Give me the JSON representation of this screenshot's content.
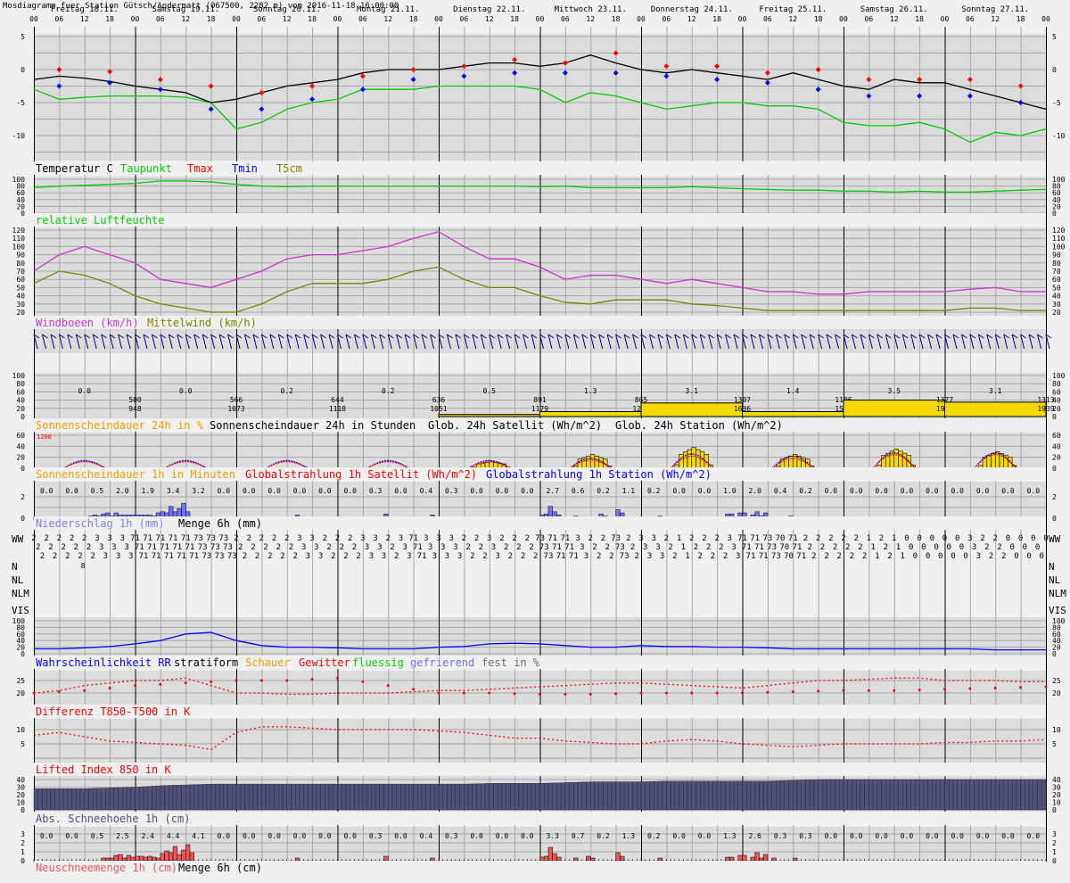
{
  "title": "Mosdiagramm fuer Station Gütsch/Andermatt (067500, 2282 m) vom 2016-11-18 16:00:00",
  "colors": {
    "temp": "#000000",
    "dew": "#00cc00",
    "tmax": "#ff0000",
    "tmin": "#0000ff",
    "gust": "#cc33cc",
    "mean": "#808000",
    "sun": "#f0a000",
    "sunbar": "#f5d800",
    "precip": "#7070ff",
    "snowh": "#50507a",
    "newsnow": "#ee5555",
    "plotbg": "#dcdcdc",
    "grid": "#a8a8a8"
  },
  "chart_data": {
    "type": "meteogram",
    "days": [
      "Freitag 18.11.",
      "Samstag 19.11.",
      "Sonntag 20.11.",
      "Montag 21.11.",
      "Dienstag 22.11.",
      "Mittwoch 23.11.",
      "Donnerstag 24.11.",
      "Freitag 25.11.",
      "Samstag 26.11.",
      "Sonntag 27.11."
    ],
    "hours": [
      "00",
      "06",
      "12",
      "18"
    ],
    "hours_end": "00",
    "x_step_hours": 6,
    "temperature": {
      "labels": [
        "Temperatur C",
        "Taupunkt",
        "Tmax",
        "Tmin",
        "T5cm"
      ],
      "ticks": [
        "5",
        "0",
        "-5",
        "-10"
      ],
      "temp": [
        -1.5,
        -1,
        -1.3,
        -1.8,
        -2.5,
        -3,
        -3.5,
        -5,
        -4.5,
        -3.5,
        -2.5,
        -2,
        -1.5,
        -0.5,
        0,
        0,
        0,
        0.5,
        1,
        1,
        0.5,
        1,
        2.2,
        1,
        0,
        -0.5,
        0,
        -0.5,
        -1,
        -1.5,
        -0.5,
        -1.5,
        -2.5,
        -3,
        -1.5,
        -2,
        -2,
        -3,
        -4,
        -5,
        -6
      ],
      "dewpoint": [
        -3,
        -4.5,
        -4.2,
        -4,
        -4,
        -4,
        -4.2,
        -5,
        -9,
        -8,
        -6,
        -5,
        -4.5,
        -3,
        -3,
        -3,
        -2.5,
        -2.5,
        -2.5,
        -2.5,
        -3,
        -5,
        -3.5,
        -4,
        -5,
        -6,
        -5.5,
        -5,
        -5,
        -5.5,
        -5.5,
        -6,
        -8,
        -8.5,
        -8.5,
        -8,
        -9,
        -11,
        -9.5,
        -10,
        -9
      ],
      "tmax": [
        0,
        -0.3,
        -1.5,
        -2.5,
        -3.5,
        -2.5,
        -1,
        0,
        0.5,
        1.5,
        1,
        2.5,
        0.5,
        0.5,
        -0.5,
        0,
        -1.5,
        -1.5,
        -1.5,
        -2.5
      ],
      "tmin": [
        -2.5,
        -2,
        -3,
        -6,
        -6,
        -4.5,
        -3,
        -1.5,
        -1,
        -0.5,
        -0.5,
        -0.5,
        -1,
        -1.5,
        -2,
        -3,
        -4,
        -4,
        -4,
        -5
      ]
    },
    "humidity": {
      "label": "relative Luftfeuchte",
      "ticks": [
        "100",
        "80",
        "60",
        "40",
        "20",
        "0"
      ],
      "values": [
        75,
        80,
        82,
        85,
        88,
        95,
        95,
        92,
        85,
        80,
        78,
        80,
        80,
        80,
        80,
        80,
        80,
        80,
        80,
        80,
        78,
        80,
        75,
        75,
        75,
        75,
        78,
        75,
        72,
        70,
        68,
        68,
        65,
        65,
        62,
        65,
        62,
        62,
        65,
        68,
        70
      ]
    },
    "wind": {
      "labels": [
        "Windboeen (km/h)",
        "Mittelwind (km/h)"
      ],
      "ticks": [
        "120",
        "110",
        "100",
        "90",
        "80",
        "70",
        "60",
        "50",
        "40",
        "30",
        "20"
      ],
      "gust": [
        70,
        90,
        100,
        90,
        80,
        60,
        55,
        50,
        60,
        70,
        85,
        90,
        90,
        95,
        100,
        110,
        118,
        100,
        85,
        85,
        75,
        60,
        65,
        65,
        60,
        55,
        60,
        55,
        50,
        45,
        45,
        42,
        42,
        45,
        45,
        45,
        45,
        48,
        50,
        45,
        45
      ],
      "mean": [
        55,
        70,
        65,
        55,
        40,
        30,
        25,
        20,
        20,
        30,
        45,
        55,
        55,
        55,
        60,
        70,
        75,
        60,
        50,
        50,
        40,
        32,
        30,
        35,
        35,
        35,
        30,
        28,
        25,
        22,
        22,
        22,
        22,
        22,
        22,
        22,
        22,
        25,
        25,
        22,
        22
      ]
    },
    "sunshine24": {
      "labels": [
        "Sonnenscheindauer 24h in %",
        "Sonnenscheindauer 24h in Stunden",
        "Glob. 24h Satellit (Wh/m^2)",
        "Glob. 24h Station (Wh/m^2)"
      ],
      "ticks": [
        "100",
        "80",
        "60",
        "40",
        "20",
        "0"
      ],
      "percent": [
        0,
        0,
        0,
        0,
        5,
        12,
        33,
        12,
        40,
        35
      ],
      "hours": [
        "0.0",
        "0.0",
        "0.2",
        "0.2",
        "0.5",
        "1.3",
        "3.1",
        "1.4",
        "3.5",
        "3.1"
      ],
      "satellite": [
        "500",
        "566",
        "644",
        "636",
        "891",
        "865",
        "1307",
        "1106",
        "1377",
        "1313"
      ],
      "station": [
        "948",
        "1073",
        "1118",
        "1051",
        "1179",
        "1250",
        "1636",
        "1559",
        "1980",
        "1939"
      ]
    },
    "sunshine1h": {
      "labels": [
        "Sonnenscheindauer 1h in Minuten",
        "Globalstrahlung 1h Satellit (Wh/m^2)",
        "Globalstrahlung 1h Station (Wh/m^2)"
      ],
      "marker": "1200",
      "ticks": [
        "60",
        "40",
        "20",
        "0"
      ],
      "daily_sun_peak_min": [
        0,
        0,
        0,
        0,
        12,
        25,
        38,
        25,
        35,
        30
      ],
      "daily_sat_peak": [
        12,
        12,
        12,
        12,
        12,
        15,
        22,
        18,
        25,
        25
      ],
      "daily_station_peak": [
        14,
        14,
        14,
        14,
        14,
        18,
        26,
        22,
        28,
        28
      ]
    },
    "precip": {
      "labels": [
        "Niederschlag 1h (mm)",
        "Menge 6h (mm)"
      ],
      "ticks": [
        "2",
        "0"
      ],
      "sum6h": [
        "0.0",
        "0.0",
        "0.5",
        "2.0",
        "1.9",
        "3.4",
        "3.2",
        "0.0",
        "0.0",
        "0.0",
        "0.0",
        "0.0",
        "0.0",
        "0.3",
        "0.0",
        "0.4",
        "0.3",
        "0.0",
        "0.0",
        "0.0",
        "2.7",
        "0.6",
        "0.2",
        "1.1",
        "0.2",
        "0.0",
        "0.0",
        "1.0",
        "2.0",
        "0.4",
        "0.2",
        "0.0",
        "0.0",
        "0.0",
        "0.0",
        "0.0",
        "0.0",
        "0.0",
        "0.0",
        "0.0"
      ],
      "hourly": [
        [
          13,
          0.2
        ],
        [
          14,
          0.3
        ],
        [
          15,
          0.2
        ],
        [
          16,
          0.4
        ],
        [
          17,
          0.5
        ],
        [
          18,
          0.2
        ],
        [
          19,
          0.5
        ],
        [
          20,
          0.3
        ],
        [
          21,
          0.3
        ],
        [
          22,
          0.3
        ],
        [
          23,
          0.3
        ],
        [
          24,
          0.3
        ],
        [
          25,
          0.3
        ],
        [
          26,
          0.3
        ],
        [
          27,
          0.3
        ],
        [
          28,
          0.2
        ],
        [
          29,
          0.5
        ],
        [
          30,
          0.6
        ],
        [
          31,
          0.5
        ],
        [
          32,
          1.1
        ],
        [
          33,
          0.6
        ],
        [
          34,
          0.9
        ],
        [
          35,
          1.4
        ],
        [
          36,
          0.6
        ],
        [
          62,
          0.3
        ],
        [
          83,
          0.4
        ],
        [
          94,
          0.3
        ],
        [
          120,
          0.3
        ],
        [
          121,
          0.4
        ],
        [
          122,
          1.1
        ],
        [
          123,
          0.6
        ],
        [
          124,
          0.3
        ],
        [
          128,
          0.2
        ],
        [
          134,
          0.4
        ],
        [
          135,
          0.2
        ],
        [
          138,
          0.8
        ],
        [
          139,
          0.5
        ],
        [
          148,
          0.2
        ],
        [
          164,
          0.4
        ],
        [
          165,
          0.4
        ],
        [
          167,
          0.5
        ],
        [
          168,
          0.5
        ],
        [
          170,
          0.3
        ],
        [
          171,
          0.6
        ],
        [
          172,
          0.2
        ],
        [
          173,
          0.5
        ],
        [
          174,
          0.1
        ],
        [
          175,
          0.1
        ],
        [
          176,
          0.1
        ],
        [
          179,
          0.2
        ]
      ]
    },
    "weather_rows": {
      "labels": [
        "WW",
        "N",
        "NL",
        "NLM",
        "VIS"
      ],
      "ww_3h": [
        "2",
        "2",
        "2",
        "2",
        "2",
        "3",
        "3",
        "3",
        "71",
        "71",
        "71",
        "71",
        "71",
        "73",
        "73",
        "73",
        "2",
        "2",
        "2",
        "2",
        "2",
        "3",
        "3",
        "2",
        "2",
        "2",
        "3",
        "3",
        "2",
        "3",
        "71",
        "3",
        "3",
        "3",
        "2",
        "2",
        "3",
        "2",
        "2",
        "2",
        "73",
        "71",
        "71",
        "3",
        "2",
        "2",
        "73",
        "2",
        "3",
        "3",
        "2",
        "1",
        "2",
        "2",
        "2",
        "3",
        "71",
        "71",
        "73",
        "70",
        "71",
        "2",
        "2",
        "2",
        "2",
        "2",
        "1",
        "2",
        "1",
        "0",
        "0",
        "0",
        "0",
        "0",
        "3",
        "2",
        "2",
        "0",
        "0",
        "0"
      ],
      "n_value": "8"
    },
    "probability": {
      "labels": [
        "Wahrscheinlichkeit RR",
        "stratiform",
        "Schauer",
        "Gewitter",
        "fluessig",
        "gefrierend",
        "fest in %"
      ],
      "ticks": [
        "100",
        "80",
        "60",
        "40",
        "20",
        "0"
      ],
      "stratiform": [
        15,
        15,
        18,
        22,
        30,
        40,
        60,
        65,
        40,
        25,
        20,
        20,
        18,
        15,
        15,
        15,
        20,
        22,
        30,
        32,
        30,
        25,
        20,
        20,
        25,
        22,
        22,
        20,
        20,
        18,
        15,
        15,
        15,
        15,
        15,
        15,
        15,
        15,
        12,
        12,
        12
      ]
    },
    "t850_t500": {
      "label": "Differenz T850-T500 in K",
      "ticks": [
        "25",
        "20"
      ],
      "values": [
        20,
        21,
        23,
        24,
        25,
        25,
        26,
        23,
        20,
        20,
        19.5,
        19.5,
        20,
        20,
        20,
        20.5,
        21,
        21,
        21.5,
        22,
        22.5,
        23,
        23.5,
        24,
        24,
        23.5,
        23,
        22.5,
        22,
        23,
        24,
        25,
        25,
        25.5,
        26,
        26,
        25,
        25,
        25,
        24.5,
        24.5
      ]
    },
    "lifted_index": {
      "label": "Lifted Index 850 in K",
      "ticks": [
        "10",
        "5"
      ],
      "values": [
        8,
        9,
        7.5,
        6,
        5.5,
        5,
        4.5,
        3,
        9,
        11,
        11,
        10.5,
        10,
        10,
        10,
        10,
        9.5,
        9,
        8,
        7,
        7,
        6,
        5.5,
        5,
        5,
        6,
        6.5,
        6,
        5,
        4.5,
        4,
        4.5,
        5,
        5,
        5,
        5,
        5.5,
        5.5,
        6,
        6,
        6.5
      ]
    },
    "snow_height": {
      "label": "Abs. Schneehoehe 1h (cm)",
      "ticks": [
        "40",
        "30",
        "20",
        "10",
        "0"
      ],
      "values": [
        28,
        28,
        28,
        29,
        30,
        32,
        33,
        34,
        34,
        34,
        34,
        34,
        34,
        34,
        34,
        34,
        34,
        34,
        35,
        35,
        35,
        36,
        37,
        37,
        37,
        38,
        38,
        38,
        38,
        38,
        39,
        40,
        40,
        40,
        40,
        40,
        40,
        40,
        40,
        40,
        40
      ]
    },
    "new_snow": {
      "labels": [
        "Neuschneemenge 1h (cm)",
        "Menge 6h (cm)"
      ],
      "ticks": [
        "3",
        "2",
        "1",
        "0"
      ],
      "sum6h": [
        "0.0",
        "0.0",
        "0.5",
        "2.5",
        "2.4",
        "4.4",
        "4.1",
        "0.0",
        "0.0",
        "0.0",
        "0.0",
        "0.0",
        "0.0",
        "0.3",
        "0.0",
        "0.4",
        "0.3",
        "0.0",
        "0.0",
        "0.0",
        "3.3",
        "0.7",
        "0.2",
        "1.3",
        "0.2",
        "0.0",
        "0.0",
        "1.3",
        "2.6",
        "0.3",
        "0.3",
        "0.0",
        "0.0",
        "0.0",
        "0.0",
        "0.0",
        "0.0",
        "0.0",
        "0.0",
        "0.0"
      ],
      "hourly": [
        [
          16,
          0.3
        ],
        [
          17,
          0.3
        ],
        [
          18,
          0.3
        ],
        [
          19,
          0.6
        ],
        [
          20,
          0.7
        ],
        [
          21,
          0.3
        ],
        [
          22,
          0.6
        ],
        [
          23,
          0.4
        ],
        [
          24,
          0.5
        ],
        [
          25,
          0.5
        ],
        [
          26,
          0.4
        ],
        [
          27,
          0.5
        ],
        [
          28,
          0.4
        ],
        [
          29,
          0.3
        ],
        [
          30,
          0.8
        ],
        [
          31,
          1.1
        ],
        [
          32,
          0.9
        ],
        [
          33,
          1.6
        ],
        [
          34,
          0.7
        ],
        [
          35,
          1.2
        ],
        [
          36,
          1.8
        ],
        [
          37,
          0.9
        ],
        [
          62,
          0.3
        ],
        [
          83,
          0.5
        ],
        [
          94,
          0.3
        ],
        [
          120,
          0.4
        ],
        [
          121,
          0.5
        ],
        [
          122,
          1.5
        ],
        [
          123,
          0.8
        ],
        [
          124,
          0.4
        ],
        [
          128,
          0.3
        ],
        [
          131,
          0.5
        ],
        [
          132,
          0.3
        ],
        [
          138,
          0.9
        ],
        [
          139,
          0.5
        ],
        [
          148,
          0.3
        ],
        [
          164,
          0.4
        ],
        [
          165,
          0.4
        ],
        [
          167,
          0.6
        ],
        [
          168,
          0.6
        ],
        [
          170,
          0.4
        ],
        [
          171,
          0.9
        ],
        [
          172,
          0.3
        ],
        [
          173,
          0.7
        ],
        [
          175,
          0.3
        ],
        [
          180,
          0.3
        ]
      ]
    }
  }
}
